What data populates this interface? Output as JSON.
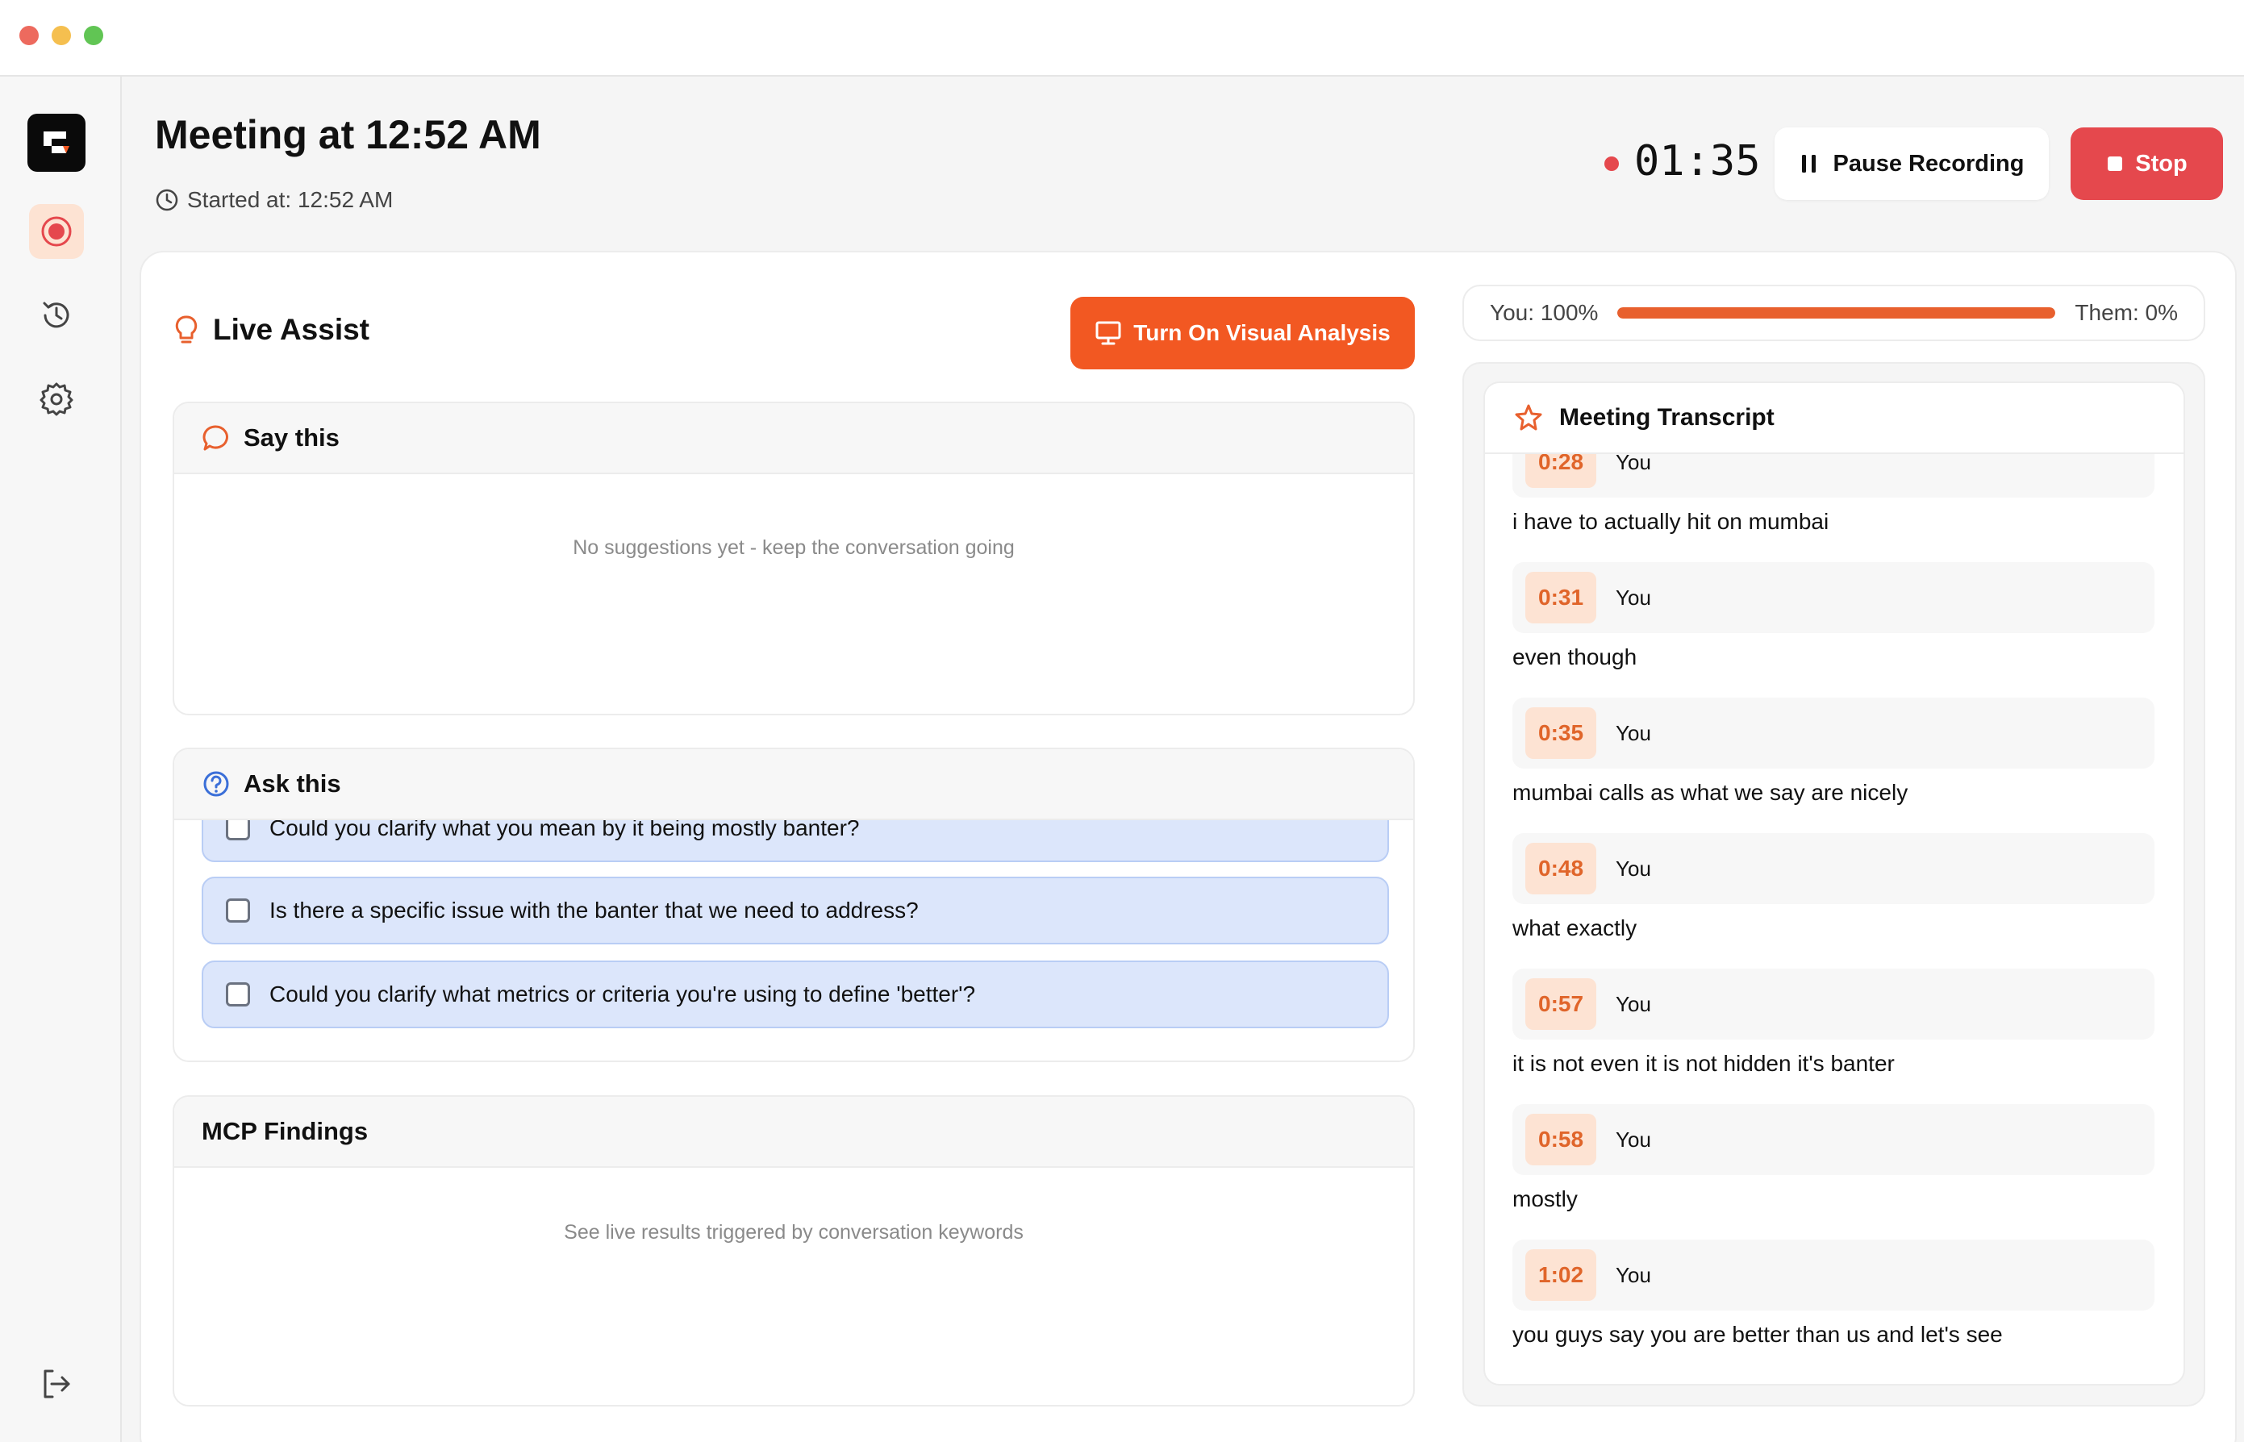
{
  "window": {
    "traffic_lights": [
      "close",
      "minimize",
      "maximize"
    ]
  },
  "sidebar": {
    "items": [
      {
        "icon": "app-logo"
      },
      {
        "icon": "record-icon",
        "active": true
      },
      {
        "icon": "history-icon"
      },
      {
        "icon": "settings-icon"
      },
      {
        "icon": "logout-icon"
      }
    ]
  },
  "header": {
    "title": "Meeting at 12:52 AM",
    "started_at": "Started at: 12:52 AM",
    "timer": "01:35",
    "pause_label": "Pause Recording",
    "stop_label": "Stop"
  },
  "live_assist": {
    "title": "Live Assist",
    "visual_button": "Turn On Visual Analysis",
    "say_this": {
      "title": "Say this",
      "empty": "No suggestions yet - keep the conversation going"
    },
    "ask_this": {
      "title": "Ask this",
      "questions": [
        "Could you clarify what you mean by it being mostly banter?",
        "Is there a specific issue with the banter that we need to address?",
        "Could you clarify what metrics or criteria you're using to define 'better'?"
      ]
    },
    "mcp": {
      "title": "MCP Findings",
      "empty": "See live results triggered by conversation keywords"
    }
  },
  "talk_ratio": {
    "you_label": "You: 100%",
    "them_label": "Them: 0%",
    "you_fraction": 1.0
  },
  "transcript": {
    "title": "Meeting Transcript",
    "entries": [
      {
        "time": "0:28",
        "speaker": "You",
        "text": "i have to actually hit on mumbai"
      },
      {
        "time": "0:31",
        "speaker": "You",
        "text": "even though"
      },
      {
        "time": "0:35",
        "speaker": "You",
        "text": "mumbai calls as what we say are nicely"
      },
      {
        "time": "0:48",
        "speaker": "You",
        "text": "what exactly"
      },
      {
        "time": "0:57",
        "speaker": "You",
        "text": "it is not even it is not hidden it's banter"
      },
      {
        "time": "0:58",
        "speaker": "You",
        "text": "mostly"
      },
      {
        "time": "1:02",
        "speaker": "You",
        "text": "you guys say you are better than us and let's see"
      }
    ]
  },
  "colors": {
    "accent": "#f25822",
    "stop": "#e5484d",
    "question_bg": "#dce6fb",
    "time_badge_bg": "#fde3d3"
  }
}
